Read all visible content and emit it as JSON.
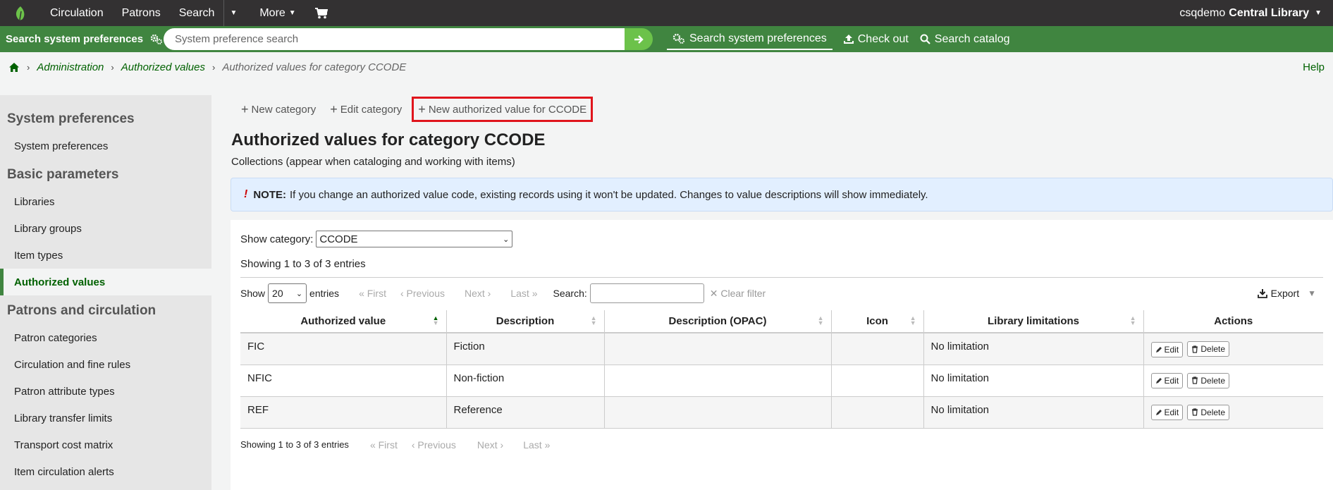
{
  "topnav": {
    "items": [
      "Circulation",
      "Patrons",
      "Search"
    ],
    "more": "More",
    "user": "csqdemo",
    "library": "Central Library"
  },
  "greenbar": {
    "label": "Search system preferences",
    "placeholder": "System preference search",
    "tabs": [
      "Search system preferences",
      "Check out",
      "Search catalog"
    ]
  },
  "breadcrumb": {
    "items": [
      "Administration",
      "Authorized values"
    ],
    "current": "Authorized values for category CCODE",
    "help": "Help"
  },
  "sidebar": {
    "sections": [
      {
        "title": "System preferences",
        "items": [
          "System preferences"
        ]
      },
      {
        "title": "Basic parameters",
        "items": [
          "Libraries",
          "Library groups",
          "Item types",
          "Authorized values"
        ]
      },
      {
        "title": "Patrons and circulation",
        "items": [
          "Patron categories",
          "Circulation and fine rules",
          "Patron attribute types",
          "Library transfer limits",
          "Transport cost matrix",
          "Item circulation alerts"
        ]
      }
    ]
  },
  "toolbar": {
    "new_category": "New category",
    "edit_category": "Edit category",
    "new_value": "New authorized value for CCODE"
  },
  "main": {
    "title": "Authorized values for category CCODE",
    "subtitle": "Collections (appear when cataloging and working with items)",
    "note_label": "NOTE:",
    "note_text": "If you change an authorized value code, existing records using it won't be updated. Changes to value descriptions will show immediately.",
    "show_category_label": "Show category:",
    "show_category_value": "CCODE",
    "entries_info": "Showing 1 to 3 of 3 entries"
  },
  "datatable": {
    "show_label": "Show",
    "page_size": "20",
    "entries_label": "entries",
    "pager": {
      "first": "First",
      "previous": "Previous",
      "next": "Next",
      "last": "Last"
    },
    "search_label": "Search:",
    "clear_filter": "Clear filter",
    "export": "Export",
    "columns": [
      "Authorized value",
      "Description",
      "Description (OPAC)",
      "Icon",
      "Library limitations",
      "Actions"
    ],
    "rows": [
      {
        "value": "FIC",
        "description": "Fiction",
        "opac": "",
        "icon": "",
        "limitations": "No limitation"
      },
      {
        "value": "NFIC",
        "description": "Non-fiction",
        "opac": "",
        "icon": "",
        "limitations": "No limitation"
      },
      {
        "value": "REF",
        "description": "Reference",
        "opac": "",
        "icon": "",
        "limitations": "No limitation"
      }
    ],
    "edit_label": "Edit",
    "delete_label": "Delete",
    "bottom_info": "Showing 1 to 3 of 3 entries"
  },
  "colors": {
    "green": "#408540",
    "dark": "#333132",
    "highlight": "#e0151c",
    "link": "#006100"
  }
}
